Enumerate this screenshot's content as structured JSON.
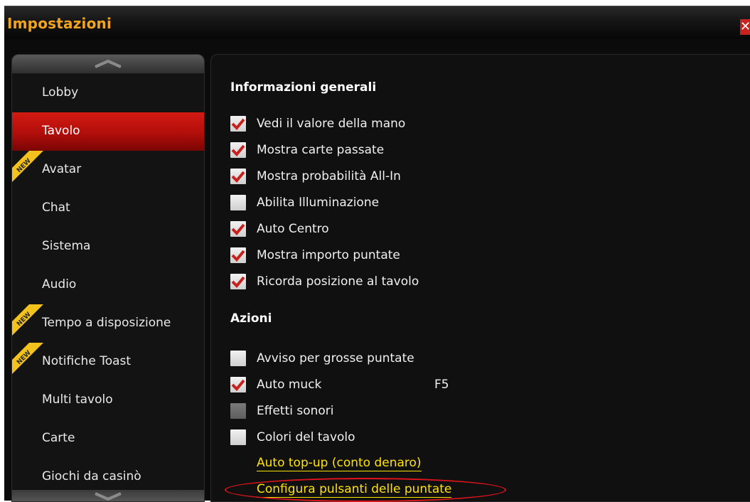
{
  "window": {
    "title": "Impostazioni",
    "close_glyph": "✕"
  },
  "sidebar": {
    "items": [
      {
        "label": "Lobby",
        "active": false,
        "new": false
      },
      {
        "label": "Tavolo",
        "active": true,
        "new": false
      },
      {
        "label": "Avatar",
        "active": false,
        "new": true
      },
      {
        "label": "Chat",
        "active": false,
        "new": false
      },
      {
        "label": "Sistema",
        "active": false,
        "new": false
      },
      {
        "label": "Audio",
        "active": false,
        "new": false
      },
      {
        "label": "Tempo a disposizione",
        "active": false,
        "new": true
      },
      {
        "label": "Notifiche Toast",
        "active": false,
        "new": true
      },
      {
        "label": "Multi tavolo",
        "active": false,
        "new": false
      },
      {
        "label": "Carte",
        "active": false,
        "new": false
      },
      {
        "label": "Giochi da casinò",
        "active": false,
        "new": false
      }
    ],
    "new_badge_text": "NEW"
  },
  "main": {
    "general": {
      "title": "Informazioni generali",
      "options": [
        {
          "label": "Vedi il valore della mano",
          "checked": true
        },
        {
          "label": "Mostra carte passate",
          "checked": true
        },
        {
          "label": "Mostra probabilità All-In",
          "checked": true
        },
        {
          "label": "Abilita Illuminazione",
          "checked": false
        },
        {
          "label": "Auto Centro",
          "checked": true
        },
        {
          "label": "Mostra importo puntate",
          "checked": true
        },
        {
          "label": "Ricorda posizione al tavolo",
          "checked": true
        }
      ]
    },
    "actions": {
      "title": "Azioni",
      "options": [
        {
          "label": "Avviso per grosse puntate",
          "checked": false
        },
        {
          "label": "Auto muck",
          "checked": true,
          "hotkey": "F5"
        },
        {
          "label": "Effetti sonori",
          "checked": false,
          "disabled": true
        },
        {
          "label": "Colori del tavolo",
          "checked": false
        }
      ],
      "links": [
        "Auto top-up (conto denaro)",
        "Configura pulsanti delle puntate"
      ]
    }
  },
  "colors": {
    "title": "#f2a51d",
    "active_tab": "#c8150e",
    "link": "#ffe300",
    "check": "#c8201c",
    "highlight": "#e0141a"
  }
}
